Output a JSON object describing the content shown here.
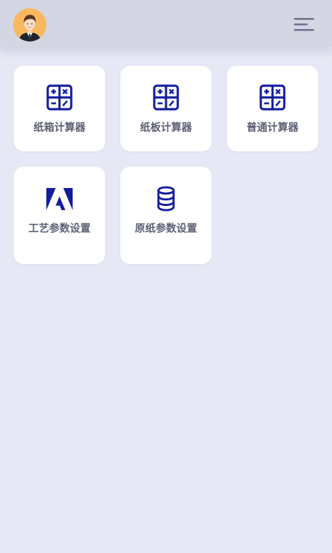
{
  "header": {
    "avatar_icon": "user-avatar",
    "menu_icon": "menu-align-right-icon"
  },
  "colors": {
    "background": "#e7e8f5",
    "header": "#d4d6e3",
    "icon_blue": "#131d9c",
    "label_text": "#5d6075",
    "avatar_bg": "#f9b85f"
  },
  "tiles": [
    {
      "label": "纸箱计算器",
      "icon": "calculator-icon"
    },
    {
      "label": "纸板计算器",
      "icon": "calculator-icon"
    },
    {
      "label": "普通计算器",
      "icon": "calculator-icon"
    },
    {
      "label": "工艺参数设置",
      "icon": "adobe-logo-icon"
    },
    {
      "label": "原纸参数设置",
      "icon": "database-icon"
    }
  ]
}
